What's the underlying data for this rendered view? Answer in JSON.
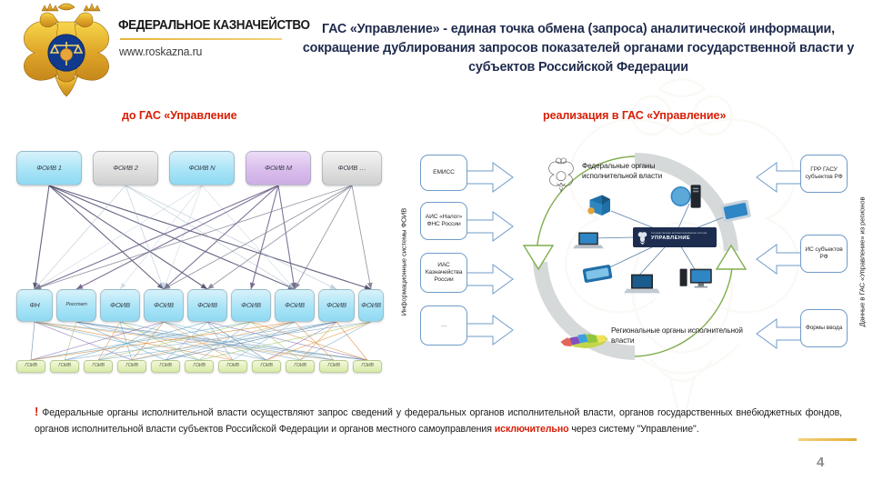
{
  "logo": {
    "title": "ФЕДЕРАЛЬНОЕ КАЗНАЧЕЙСТВО",
    "url": "www.roskazna.ru",
    "emblem": "russian-federation-eagle-emblem"
  },
  "headline": "ГАС «Управление» - единая точка обмена (запроса) аналитической информации, сокращение дублирования запросов показателей органами государственной власти у субъектов Российской Федерации",
  "captions": {
    "left": "до ГАС «Управление",
    "right": "реализация в ГАС «Управление»"
  },
  "left_diagram": {
    "row1": [
      {
        "label": "ФОИВ 1",
        "color": "blue"
      },
      {
        "label": "ФОИВ 2",
        "color": "grey"
      },
      {
        "label": "ФОИВ N",
        "color": "blue"
      },
      {
        "label": "ФОИВ М",
        "color": "purple"
      },
      {
        "label": "ФОИВ …",
        "color": "grey"
      }
    ],
    "row2": [
      {
        "label": "ФН"
      },
      {
        "label": "Росстат"
      },
      {
        "label": "ФОИВ"
      },
      {
        "label": "ФОИВ"
      },
      {
        "label": "ФОИВ"
      },
      {
        "label": "ФОИВ"
      },
      {
        "label": "ФОИВ"
      },
      {
        "label": "ФОИВ"
      },
      {
        "label": "ФОИВ"
      }
    ],
    "row3": [
      {
        "label": "ГОИВ"
      },
      {
        "label": "ГОИВ"
      },
      {
        "label": "ГОИВ"
      },
      {
        "label": "ГОИВ"
      },
      {
        "label": "ГОИВ"
      },
      {
        "label": "ГОИВ"
      },
      {
        "label": "ГОИВ"
      },
      {
        "label": "ГОИВ"
      },
      {
        "label": "ГОИВ"
      },
      {
        "label": "ГОИВ"
      },
      {
        "label": "ГОИВ"
      }
    ]
  },
  "right_diagram": {
    "left_axis_label": "Информационные системы ФОИВ",
    "right_axis_label": "Данные в ГАС «Управление» из регионов",
    "left_boxes": [
      {
        "label": "ЕМИСС"
      },
      {
        "label": "АИС «Налог» ФНС России"
      },
      {
        "label": "ИАС Казначейства России"
      },
      {
        "label": "…"
      }
    ],
    "right_boxes": [
      {
        "label": "ГРР ГАСУ субъектов РФ"
      },
      {
        "label": "ИС субъектов РФ"
      },
      {
        "label": "Формы ввода"
      }
    ],
    "top_group": "Федеральные органы исполнительной власти",
    "bottom_group": "Региональные органы исполнительной власти",
    "hub": {
      "small": "Государственная автоматизированная система",
      "big": "УПРАВЛЕНИЕ"
    },
    "map_label": "russia-regions-map"
  },
  "footnote": {
    "marker": "!",
    "part1": "Федеральные органы исполнительной власти осуществляют запрос сведений у федеральных органов исполнительной власти, органов государственных внебюджетных фондов, органов исполнительной власти субъектов Российской Федерации и органов местного самоуправления ",
    "highlight": "исключительно",
    "part2": " через систему \"Управление\"."
  },
  "page_number": "4",
  "colors": {
    "accent_red": "#d81f06",
    "headline_navy": "#1f2b4d",
    "gold": "#e3ad32",
    "box_blue_border": "#6f9bc9",
    "hub_navy": "#1d2d4f"
  }
}
